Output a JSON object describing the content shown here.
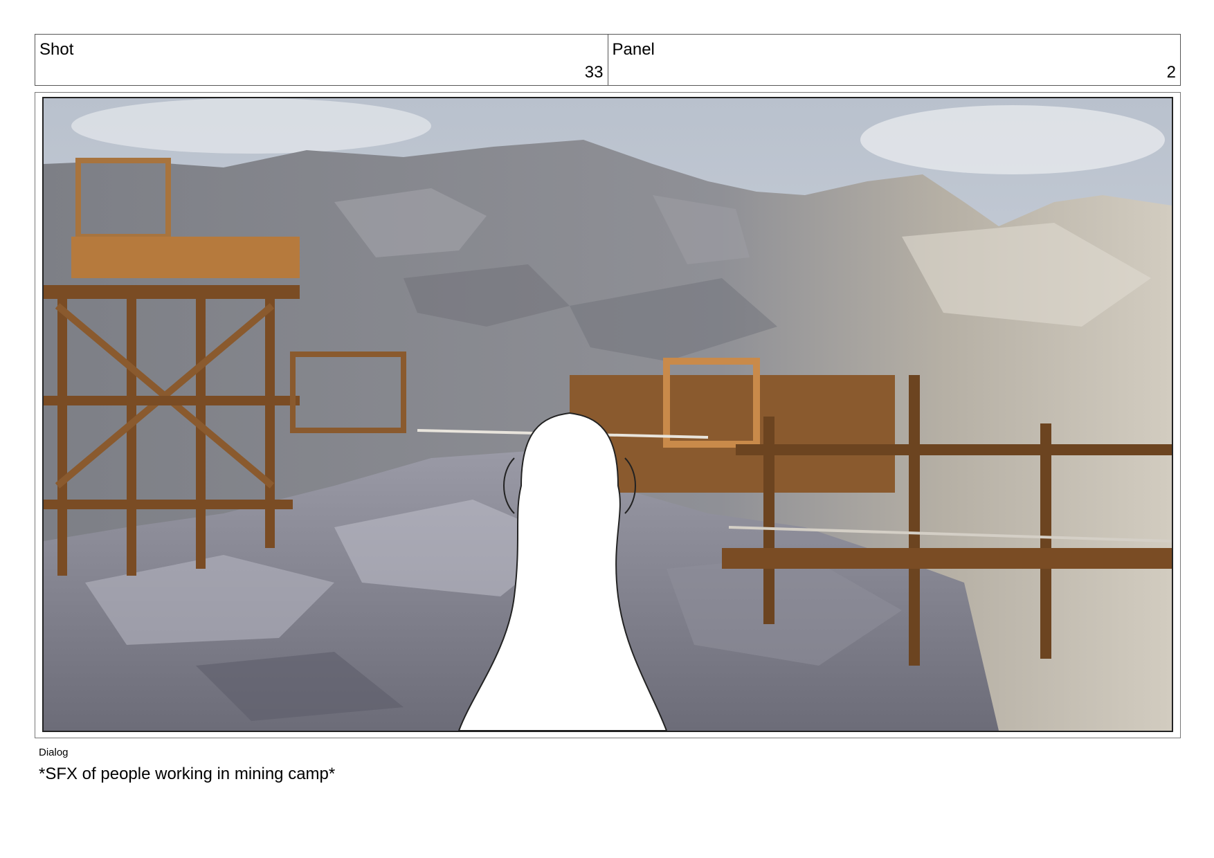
{
  "header": {
    "shot_label": "Shot",
    "shot_number": "33",
    "panel_label": "Panel",
    "panel_number": "2"
  },
  "dialog": {
    "label": "Dialog",
    "text": "*SFX of people working in mining camp*"
  },
  "colors": {
    "sky": "#c9cfd8",
    "rock": "#8e9097",
    "rock_light": "#c9c3b6",
    "wood": "#8a5a2e",
    "wood_light": "#c98a4a",
    "character": "#ffffff"
  }
}
